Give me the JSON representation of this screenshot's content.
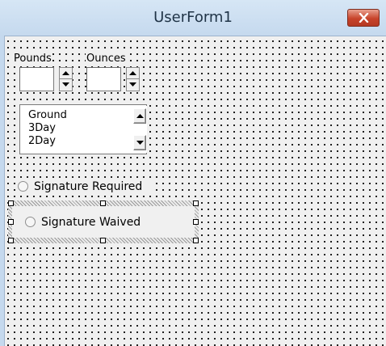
{
  "window": {
    "title": "UserForm1",
    "close_icon": "close-icon"
  },
  "form": {
    "labels": {
      "pounds": "Pounds",
      "ounces": "Ounces"
    },
    "textboxes": {
      "pounds_value": "",
      "ounces_value": ""
    },
    "spin_buttons": [
      "spin-up-icon",
      "spin-down-icon"
    ],
    "listbox": {
      "items": [
        "Ground",
        "3Day",
        "2Day"
      ]
    },
    "options": {
      "signature_required": "Signature Required",
      "signature_waived": "Signature Waived"
    }
  },
  "colors": {
    "titlebar": "#c5d9ee",
    "close_button": "#c7432a",
    "client_bg": "#f0f0f0"
  }
}
